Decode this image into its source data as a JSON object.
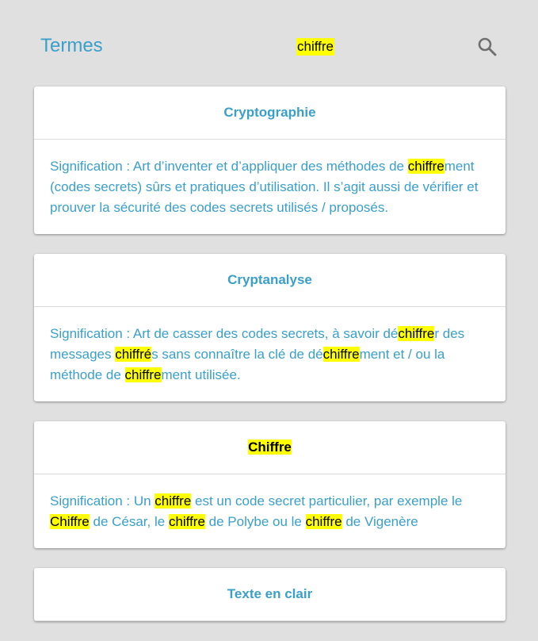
{
  "header": {
    "title": "Termes",
    "search_query": "chiffre",
    "search_icon": "search-icon"
  },
  "colors": {
    "background": "#e0e0e0",
    "accent": "#3a9fc9",
    "highlight": "#ffff00",
    "card": "#ffffff"
  },
  "highlight_term": "chiffre",
  "terms": [
    {
      "title": "Cryptographie",
      "description": "Signification : Art d’inventer et d’appliquer des méthodes de chiffrement (codes secrets) sûrs et pratiques d’utilisation. Il s’agit aussi de vérifier et prouver la sécurité des codes secrets utilisés / proposés."
    },
    {
      "title": "Cryptanalyse",
      "description": "Signification : Art de casser des codes secrets, à savoir déchiffrer des messages chiffrés sans connaître la clé de déchiffrement et / ou la méthode de chiffrement utilisée."
    },
    {
      "title": "Chiffre",
      "description": "Signification : Un chiffre est un code secret particulier, par exemple le Chiffre de César, le chiffre de Polybe ou le chiffre de Vigenère"
    },
    {
      "title": "Texte en clair",
      "description": ""
    }
  ]
}
